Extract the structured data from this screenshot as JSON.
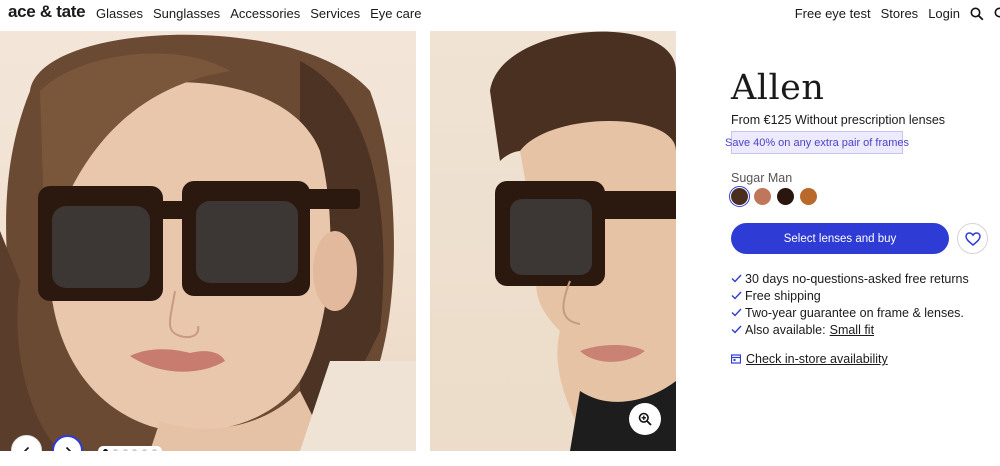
{
  "header": {
    "logo": "ace & tate",
    "nav_left": [
      "Glasses",
      "Sunglasses",
      "Accessories",
      "Services",
      "Eye care"
    ],
    "nav_right": [
      "Free eye test",
      "Stores",
      "Login"
    ]
  },
  "gallery": {
    "dots_count": 6,
    "active_dot": 0
  },
  "product": {
    "name": "Allen",
    "price_prefix": "From",
    "price": "€125",
    "price_suffix": "Without prescription lenses",
    "promo": "Save 40% on any extra pair of frames",
    "color_name": "Sugar Man",
    "swatch_colors": [
      "#4a2e1f",
      "#c0765a",
      "#2a160e",
      "#b9692c"
    ],
    "buy_label": "Select lenses and buy",
    "benefits": [
      "30 days no-questions-asked free returns",
      "Free shipping",
      "Two-year guarantee on frame & lenses."
    ],
    "also_available_label": "Also available:",
    "also_available_link": "Small fit",
    "store_check": "Check in-store availability"
  },
  "colors": {
    "accent": "#2f3bd5",
    "promo_bg": "#eceafc",
    "promo_text": "#4a43c4"
  }
}
